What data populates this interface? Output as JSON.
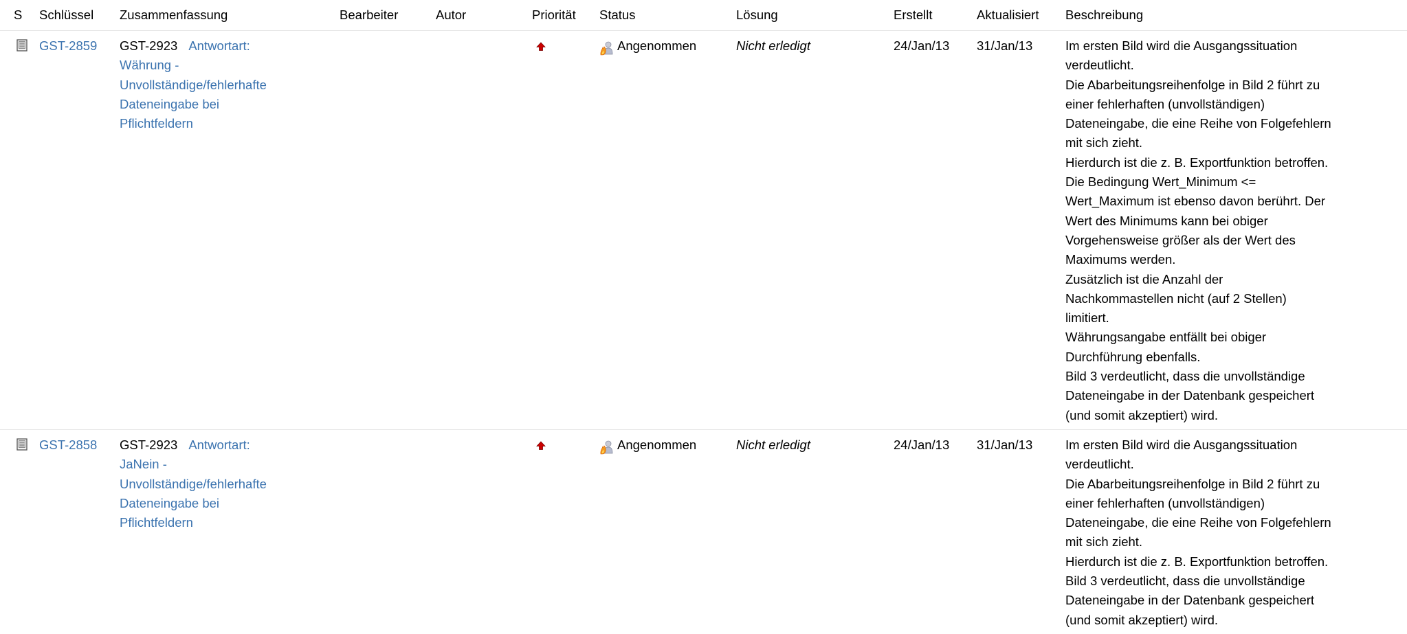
{
  "columns": {
    "s": "S",
    "key": "Schlüssel",
    "summary": "Zusammenfassung",
    "assignee": "Bearbeiter",
    "reporter": "Autor",
    "priority": "Priorität",
    "status": "Status",
    "resolution": "Lösung",
    "created": "Erstellt",
    "updated": "Aktualisiert",
    "description": "Beschreibung"
  },
  "issues": [
    {
      "key": "GST-2859",
      "parent_key": "GST-2923",
      "summary_lines": [
        "Antwortart:",
        "Währung -",
        "Unvollständige/fehlerhafte",
        "Dateneingabe bei",
        "Pflichtfeldern"
      ],
      "assignee": "",
      "reporter": "",
      "priority_icon": "priority-up-arrow-icon",
      "status": "Angenommen",
      "status_icon": "accepted-status-icon",
      "resolution": "Nicht erledigt",
      "created": "24/Jan/13",
      "updated": "31/Jan/13",
      "description_lines": [
        "Im ersten Bild wird die Ausgangssituation",
        "verdeutlicht.",
        "Die Abarbeitungsreihenfolge in Bild 2 führt zu",
        "einer fehlerhaften (unvollständigen)",
        "Dateneingabe, die eine Reihe von Folgefehlern",
        "mit sich zieht.",
        "Hierdurch ist die z. B. Exportfunktion betroffen.",
        "Die Bedingung Wert_Minimum <=",
        "Wert_Maximum ist ebenso davon berührt. Der",
        "Wert des Minimums kann bei obiger",
        "Vorgehensweise größer als der Wert des",
        "Maximums werden.",
        "Zusätzlich ist die Anzahl der",
        "Nachkommastellen nicht (auf 2 Stellen)",
        "limitiert.",
        "Währungsangabe entfällt bei obiger",
        "Durchführung ebenfalls.",
        "Bild 3 verdeutlicht, dass die unvollständige",
        "Dateneingabe in der Datenbank gespeichert",
        "(und somit akzeptiert) wird."
      ]
    },
    {
      "key": "GST-2858",
      "parent_key": "GST-2923",
      "summary_lines": [
        "Antwortart:",
        "JaNein -",
        "Unvollständige/fehlerhafte",
        "Dateneingabe bei",
        "Pflichtfeldern"
      ],
      "assignee": "",
      "reporter": "",
      "priority_icon": "priority-up-arrow-icon",
      "status": "Angenommen",
      "status_icon": "accepted-status-icon",
      "resolution": "Nicht erledigt",
      "created": "24/Jan/13",
      "updated": "31/Jan/13",
      "description_lines": [
        "Im ersten Bild wird die Ausgangssituation",
        "verdeutlicht.",
        "Die Abarbeitungsreihenfolge in Bild 2 führt zu",
        "einer fehlerhaften (unvollständigen)",
        "Dateneingabe, die eine Reihe von Folgefehlern",
        "mit sich zieht.",
        "Hierdurch ist die z. B. Exportfunktion betroffen.",
        "Bild 3 verdeutlicht, dass die unvollständige",
        "Dateneingabe in der Datenbank gespeichert",
        "(und somit akzeptiert) wird."
      ]
    }
  ],
  "colors": {
    "link": "#3b73af",
    "priority": "#cc0000",
    "row_border": "#e6e6e6"
  }
}
